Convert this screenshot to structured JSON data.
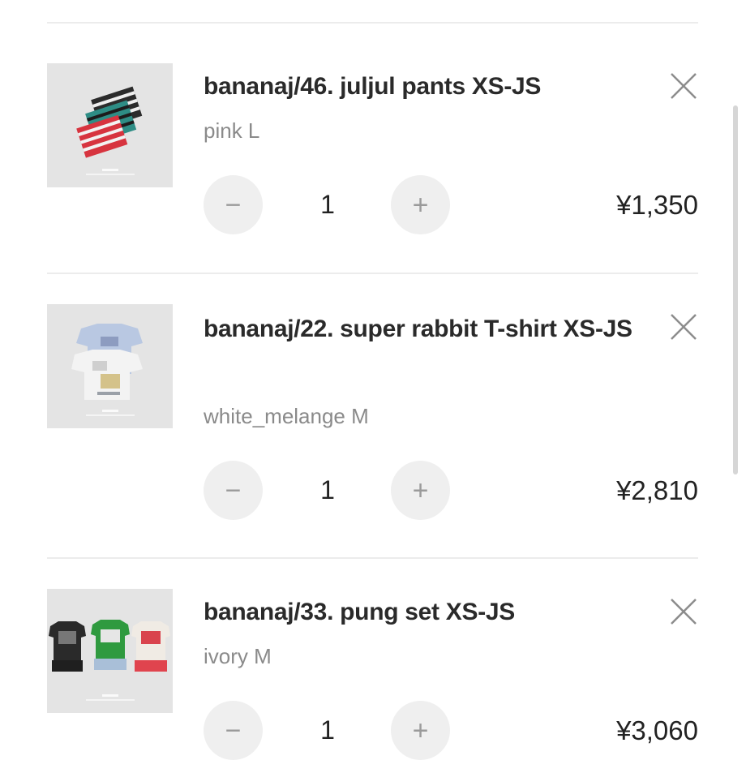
{
  "cart": {
    "items": [
      {
        "title": "bananaj/46. juljul pants XS-JS",
        "variant": "pink L",
        "quantity": "1",
        "price": "¥1,350",
        "minus_icon": "minus-icon",
        "plus_icon": "plus-icon",
        "remove_icon": "close-icon",
        "thumb_icon": "striped-shorts-image"
      },
      {
        "title": "bananaj/22. super rabbit T-shirt XS-JS",
        "variant": "white_melange M",
        "quantity": "1",
        "price": "¥2,810",
        "minus_icon": "minus-icon",
        "plus_icon": "plus-icon",
        "remove_icon": "close-icon",
        "thumb_icon": "tshirt-image"
      },
      {
        "title": "bananaj/33. pung set XS-JS",
        "variant": "ivory M",
        "quantity": "1",
        "price": "¥3,060",
        "minus_icon": "minus-icon",
        "plus_icon": "plus-icon",
        "remove_icon": "close-icon",
        "thumb_icon": "tshirt-set-image"
      }
    ]
  },
  "colors": {
    "thumb_bg": "#e4e4e4",
    "button_bg": "#efefef",
    "variant_text": "#8a8a8a",
    "divider": "#ececec"
  }
}
